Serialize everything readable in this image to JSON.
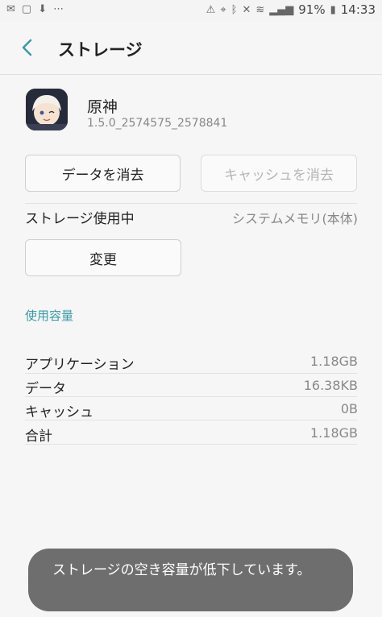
{
  "status_bar": {
    "battery": "91%",
    "time": "14:33",
    "left_icons": [
      "mail-icon",
      "line-icon",
      "download-icon",
      "more-icon"
    ],
    "right_icons": [
      "alert-icon",
      "location-icon",
      "bluetooth-icon",
      "mute-icon",
      "wifi-icon",
      "signal-icon",
      "battery-icon"
    ]
  },
  "header": {
    "title": "ストレージ"
  },
  "app": {
    "name": "原神",
    "version": "1.5.0_2574575_2578841"
  },
  "buttons": {
    "clear_data": "データを消去",
    "clear_cache": "キャッシュを消去",
    "change": "変更"
  },
  "storage_used": {
    "label": "ストレージ使用中",
    "value": "システムメモリ(本体)"
  },
  "usage": {
    "section_title": "使用容量",
    "rows": [
      {
        "label": "アプリケーション",
        "value": "1.18GB"
      },
      {
        "label": "データ",
        "value": "16.38KB"
      },
      {
        "label": "キャッシュ",
        "value": "0B"
      },
      {
        "label": "合計",
        "value": "1.18GB"
      }
    ]
  },
  "toast": {
    "message": "ストレージの空き容量が低下しています。"
  },
  "colors": {
    "accent": "#3a9aa6",
    "toast_bg": "#6e6e6e"
  }
}
